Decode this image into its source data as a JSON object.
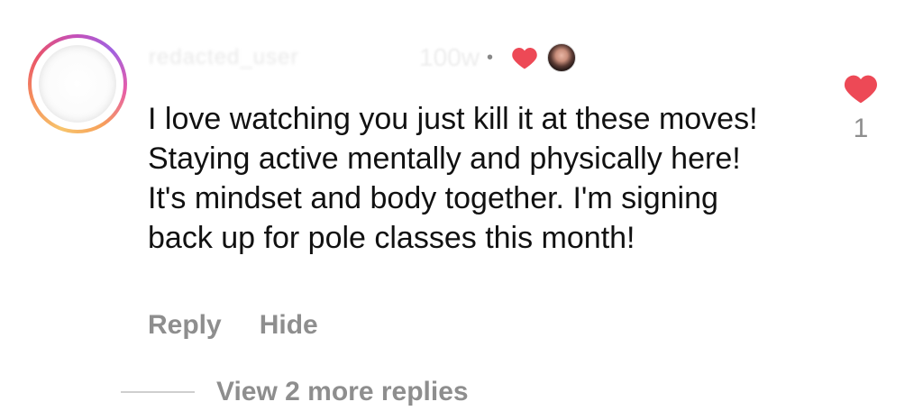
{
  "comment": {
    "username": "redacted_user",
    "time_ago": "100w",
    "separator": "•",
    "text": "I love watching you just kill it at these moves! Staying active mentally and physically here! It's mindset and body together. I'm signing back up for pole classes this month!",
    "creator_liked_icon": "heart-icon",
    "creator_avatar_icon": "creator-avatar"
  },
  "actions": {
    "reply_label": "Reply",
    "hide_label": "Hide"
  },
  "likes": {
    "icon": "heart-icon",
    "count": "1",
    "color": "#ed4956"
  },
  "replies": {
    "view_label": "View 2 more replies"
  },
  "colors": {
    "secondary_text": "#8e8e8e",
    "like_red": "#ed4956"
  }
}
